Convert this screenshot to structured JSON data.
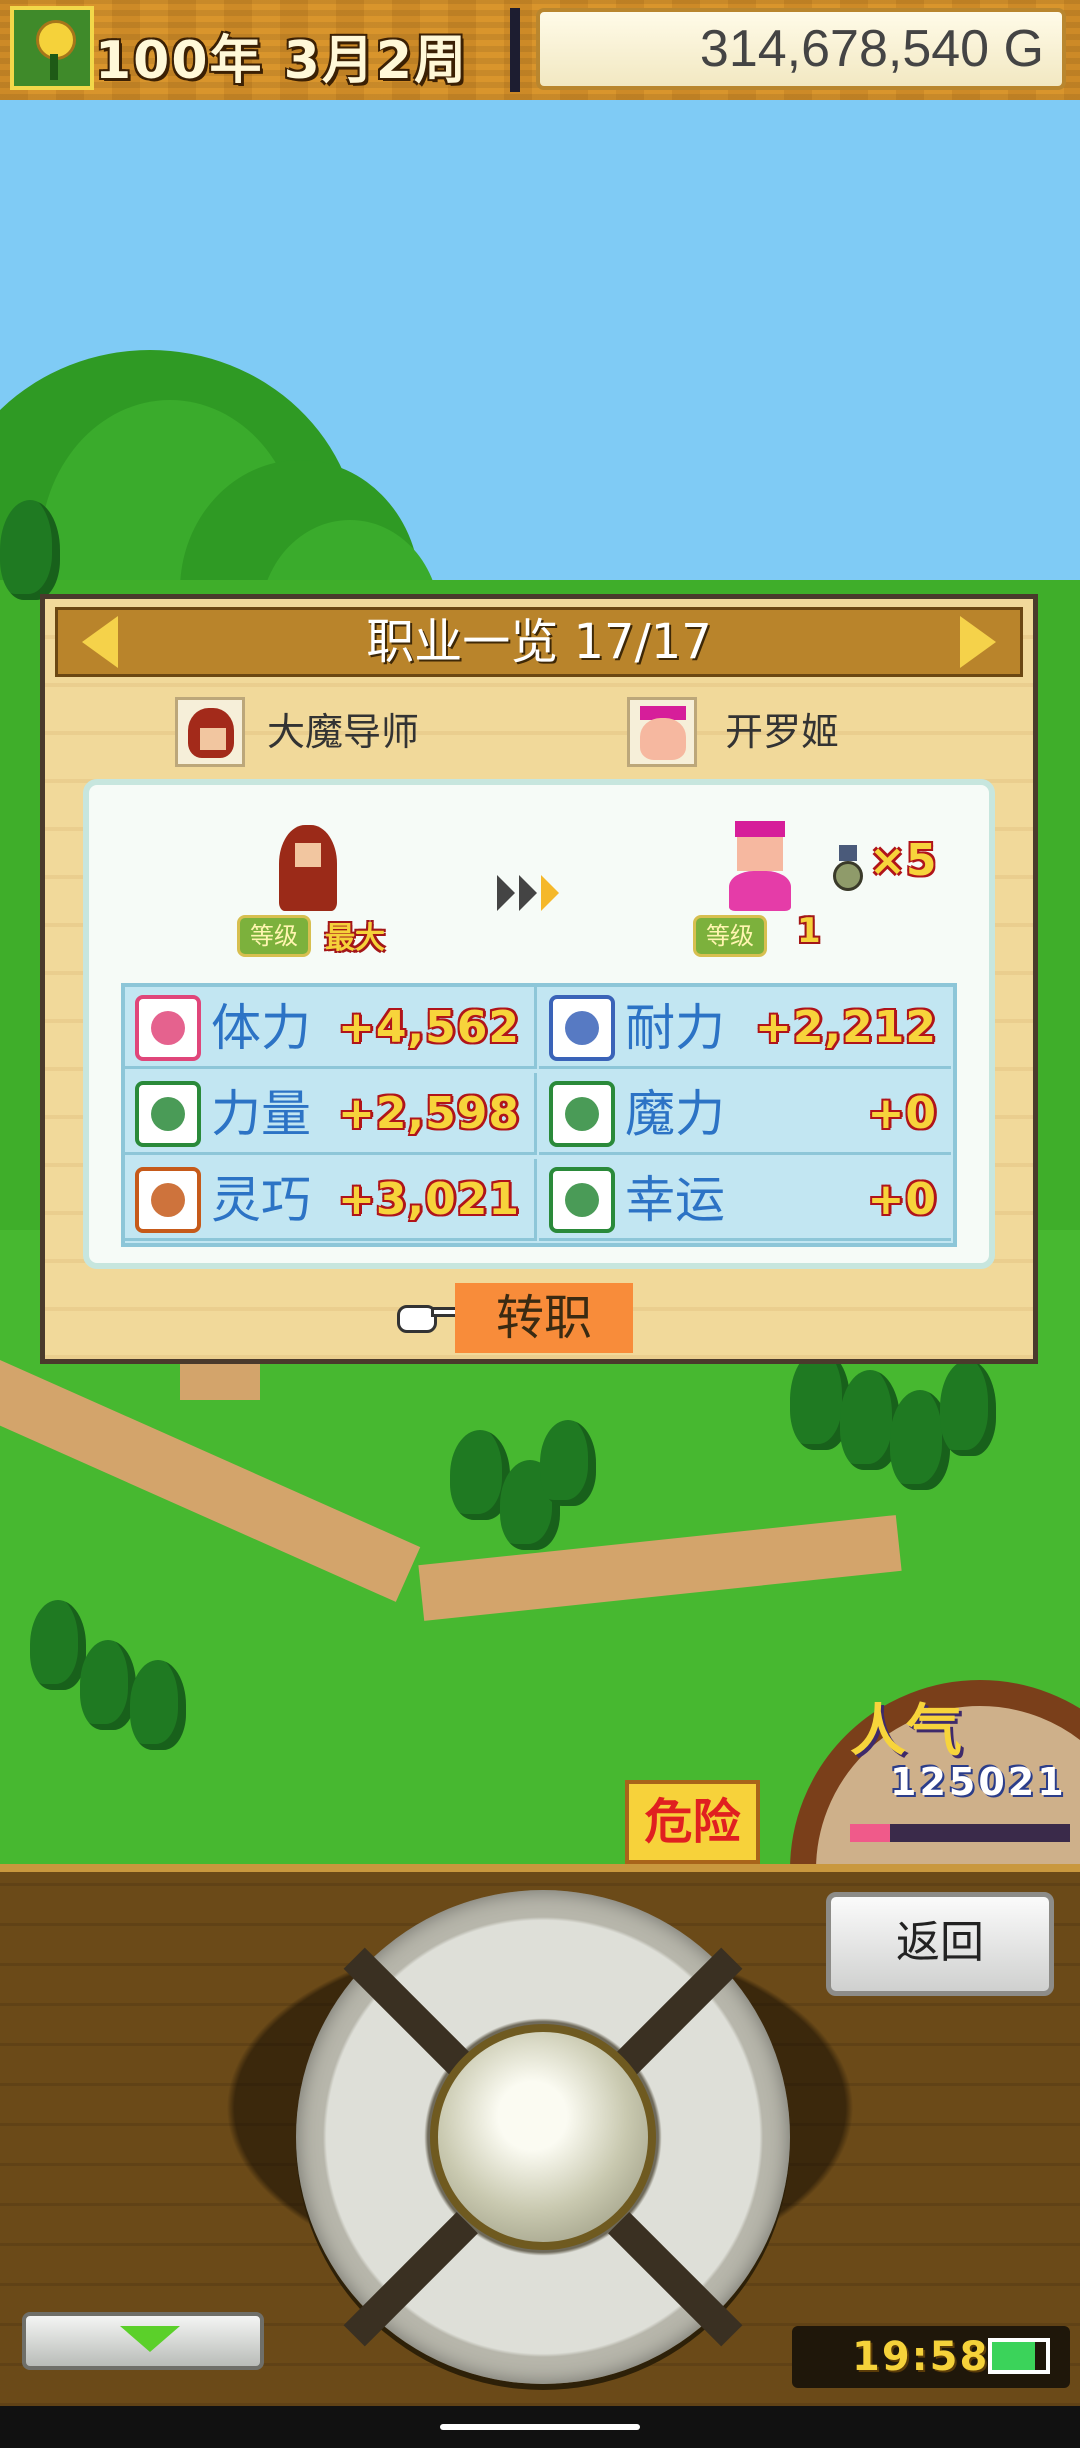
{
  "hud": {
    "date": "100年  3月2周",
    "money": "314,678,540 G",
    "icon": "flower-icon"
  },
  "dialog": {
    "title": "职业一览 17/17",
    "from_job": {
      "name": "大魔导师",
      "level_label": "等级",
      "level_value": "最大",
      "icon": "mage-portrait-icon"
    },
    "to_job": {
      "name": "开罗姬",
      "level_label": "等级",
      "level_value": "1",
      "icon": "princess-portrait-icon"
    },
    "medal_count": "×5",
    "stats": [
      {
        "label": "体力",
        "value": "+4,562",
        "icon": "heart-icon",
        "color": "#e0467a"
      },
      {
        "label": "耐力",
        "value": "+2,212",
        "icon": "shield-icon",
        "color": "#3a63b8"
      },
      {
        "label": "力量",
        "value": "+2,598",
        "icon": "muscle-icon",
        "color": "#2a8a3a"
      },
      {
        "label": "魔力",
        "value": "+0",
        "icon": "magic-hand-icon",
        "color": "#2a8a3a"
      },
      {
        "label": "灵巧",
        "value": "+3,021",
        "icon": "swords-icon",
        "color": "#c65a1a"
      },
      {
        "label": "幸运",
        "value": "+0",
        "icon": "smiley-icon",
        "color": "#2a8a3a"
      }
    ],
    "change_button": "转职"
  },
  "world": {
    "popularity_label": "人气",
    "popularity_value": "125021",
    "popularity_fill": 0.18,
    "danger_sign": "危险"
  },
  "controls": {
    "back_button": "返回",
    "clock": "19:58",
    "battery_level": 0.8
  }
}
